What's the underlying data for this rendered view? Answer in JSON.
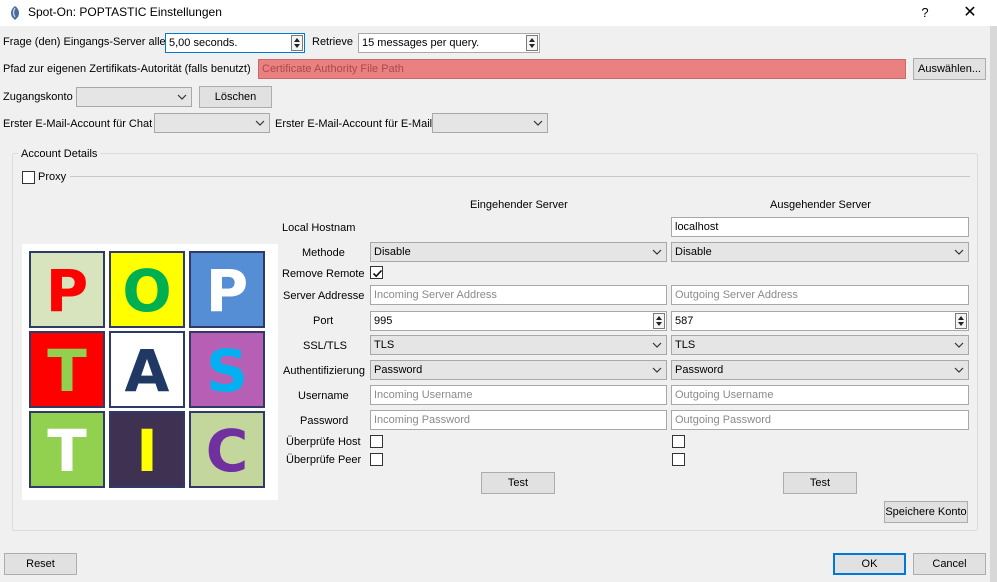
{
  "window": {
    "title": "Spot-On: POPTASTIC Einstellungen",
    "help_label": "?",
    "close_label": "✕"
  },
  "row1": {
    "query_label": "Frage (den) Eingangs-Server alle",
    "query_value": "5,00 seconds.",
    "retrieve_label": "Retrieve",
    "retrieve_value": "15 messages per query."
  },
  "row2": {
    "cert_label": "Pfad zur eigenen Zertifikats-Autorität (falls benutzt)",
    "cert_placeholder": "Certificate Authority File Path",
    "select_button": "Auswählen..."
  },
  "row3": {
    "account_label": "Zugangskonto",
    "account_value": "",
    "delete_button": "Löschen"
  },
  "row4": {
    "chat_label": "Erster E-Mail-Account für Chat",
    "chat_value": "",
    "email_label": "Erster E-Mail-Account für E-Mail",
    "email_value": ""
  },
  "account_details": {
    "title": "Account Details",
    "proxy_label": "Proxy",
    "proxy_checked": false,
    "incoming_header": "Eingehender Server",
    "outgoing_header": "Ausgehender Server",
    "labels": {
      "local_hostname": "Local Hostnam",
      "method": "Methode",
      "remove_remote": "Remove Remote",
      "server_address": "Server Addresse",
      "port": "Port",
      "ssl_tls": "SSL/TLS",
      "auth": "Authentifizierung",
      "username": "Username",
      "password": "Password",
      "verify_host": "Überprüfe Host",
      "verify_peer": "Überprüfe Peer"
    },
    "incoming": {
      "method": "Disable",
      "remove_remote_checked": true,
      "address_placeholder": "Incoming Server Address",
      "port": "995",
      "ssl": "TLS",
      "auth": "Password",
      "username_placeholder": "Incoming Username",
      "password_placeholder": "Incoming Password",
      "verify_host": false,
      "verify_peer": false,
      "test_button": "Test"
    },
    "outgoing": {
      "local_hostname": "localhost",
      "method": "Disable",
      "address_placeholder": "Outgoing Server Address",
      "port": "587",
      "ssl": "TLS",
      "auth": "Password",
      "username_placeholder": "Outgoing Username",
      "password_placeholder": "Outgoing Password",
      "verify_host": false,
      "verify_peer": false,
      "test_button": "Test"
    },
    "save_button": "Speichere Konto"
  },
  "logo": {
    "tiles": [
      {
        "letter": "P",
        "bg": "#d7e4bd",
        "fg": "#ff0000"
      },
      {
        "letter": "O",
        "bg": "#ffff00",
        "fg": "#00b050"
      },
      {
        "letter": "P",
        "bg": "#558ed5",
        "fg": "#ffffff"
      },
      {
        "letter": "T",
        "bg": "#ff0000",
        "fg": "#92d050"
      },
      {
        "letter": "A",
        "bg": "#ffffff",
        "fg": "#1f3864"
      },
      {
        "letter": "S",
        "bg": "#b65fb4",
        "fg": "#00b0f0"
      },
      {
        "letter": "T",
        "bg": "#92d050",
        "fg": "#ffffff"
      },
      {
        "letter": "I",
        "bg": "#3f3151",
        "fg": "#ffff00"
      },
      {
        "letter": "C",
        "bg": "#c3d69b",
        "fg": "#7030a0"
      }
    ]
  },
  "footer": {
    "reset_button": "Reset",
    "ok_button": "OK",
    "cancel_button": "Cancel"
  },
  "colors": {
    "cert_error_bg": "#ea8080",
    "dialog_bg": "#f0f0f0",
    "accent": "#0078d7"
  }
}
